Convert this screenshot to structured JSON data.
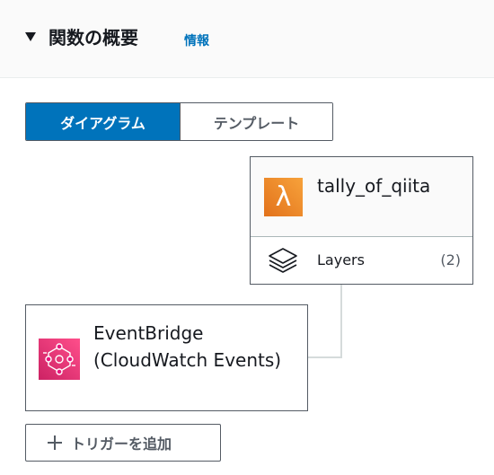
{
  "header": {
    "title": "関数の概要",
    "info_link": "情報"
  },
  "view_toggle": {
    "options": [
      "ダイアグラム",
      "テンプレート"
    ],
    "selected": "ダイアグラム"
  },
  "function_card": {
    "name": "tally_of_qiita",
    "icon": "lambda-icon",
    "layers_label": "Layers",
    "layers_count": "(2)"
  },
  "trigger_card": {
    "name": "EventBridge (CloudWatch Events)",
    "icon": "eventbridge-icon"
  },
  "add_trigger_button": {
    "label": "トリガーを追加",
    "icon": "plus-icon"
  },
  "colors": {
    "accent": "#0073bb",
    "lambda_orange": "#ed7100",
    "eventbridge_pink": "#e7157b",
    "border": "#545b64"
  }
}
